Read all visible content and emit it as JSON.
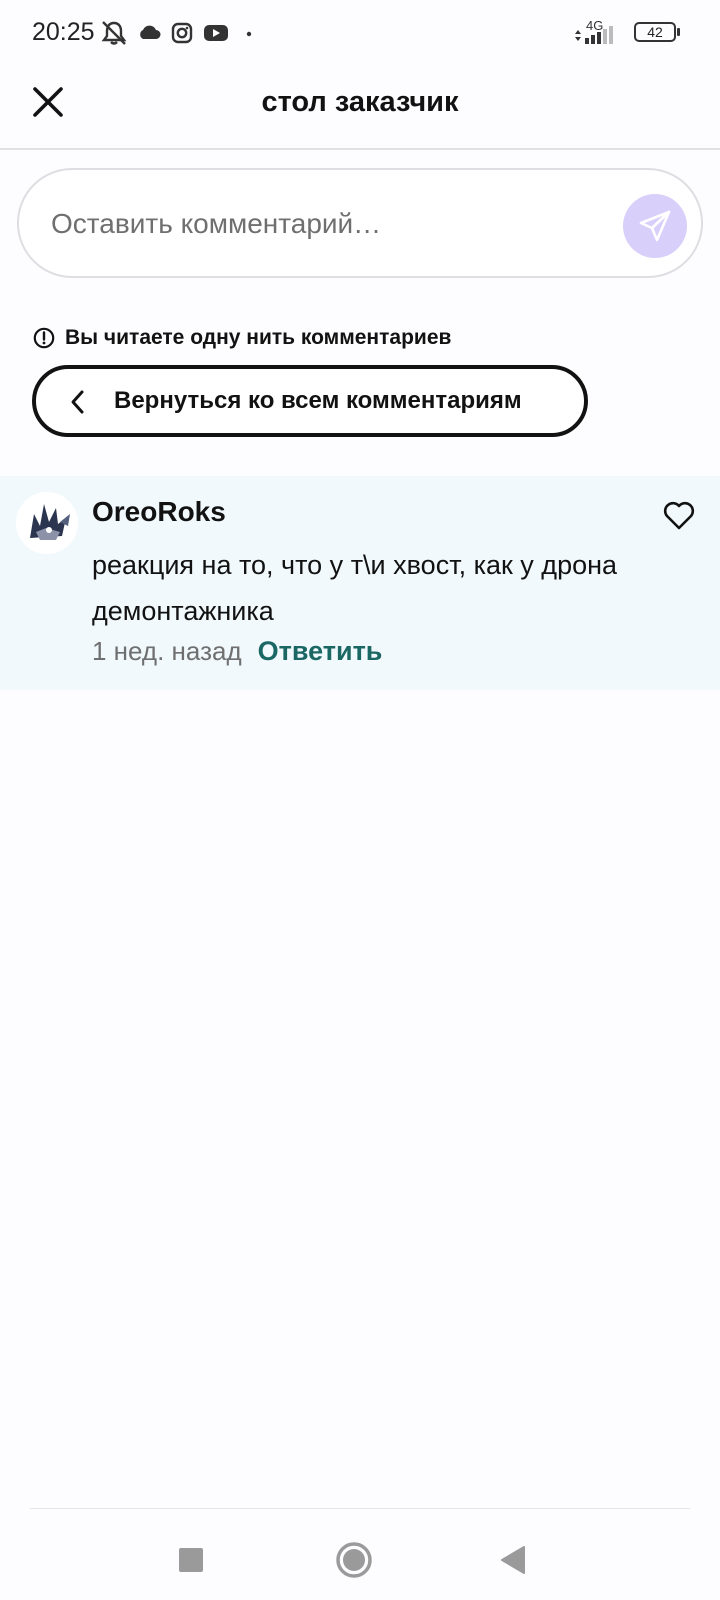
{
  "status_bar": {
    "time": "20:25",
    "network": "4G",
    "battery": "42",
    "icons": [
      "mute-icon",
      "cloud-icon",
      "instagram-icon",
      "youtube-icon",
      "dot-icon",
      "signal-icon",
      "battery-icon"
    ]
  },
  "header": {
    "title": "стол заказчик",
    "close_icon": "close-icon"
  },
  "comment_input": {
    "placeholder": "Оставить комментарий…",
    "send_icon": "send-icon"
  },
  "thread": {
    "notice": "Вы читаете одну нить комментариев",
    "back_label": "Вернуться ко всем комментариям"
  },
  "comments": [
    {
      "author": "OreoRoks",
      "text": "реакция на то, что у т\\и хвост, как у дрона демонтажника",
      "time": "1 нед. назад",
      "reply_label": "Ответить"
    }
  ],
  "colors": {
    "accent_send_bg": "#d9cffb",
    "reply": "#1a6763",
    "comment_bg": "#f1f9fd"
  }
}
